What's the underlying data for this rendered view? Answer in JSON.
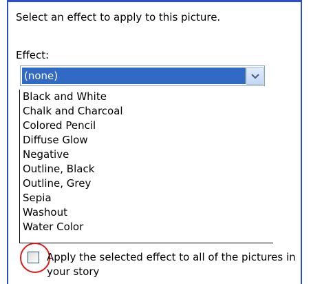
{
  "instruction": "Select an effect to apply to this picture.",
  "effect_label": "Effect:",
  "effect_select": {
    "selected": "(none)",
    "options": [
      "Black and White",
      "Chalk and Charcoal",
      "Colored Pencil",
      "Diffuse Glow",
      "Negative",
      "Outline, Black",
      "Outline, Grey",
      "Sepia",
      "Washout",
      "Water Color"
    ]
  },
  "apply_all": {
    "label": "Apply the selected effect to all of the pictures in your story",
    "checked": false
  },
  "colors": {
    "frame_border": "#2b4bd6",
    "selection": "#316ac5",
    "annotation_circle": "#e01818"
  }
}
